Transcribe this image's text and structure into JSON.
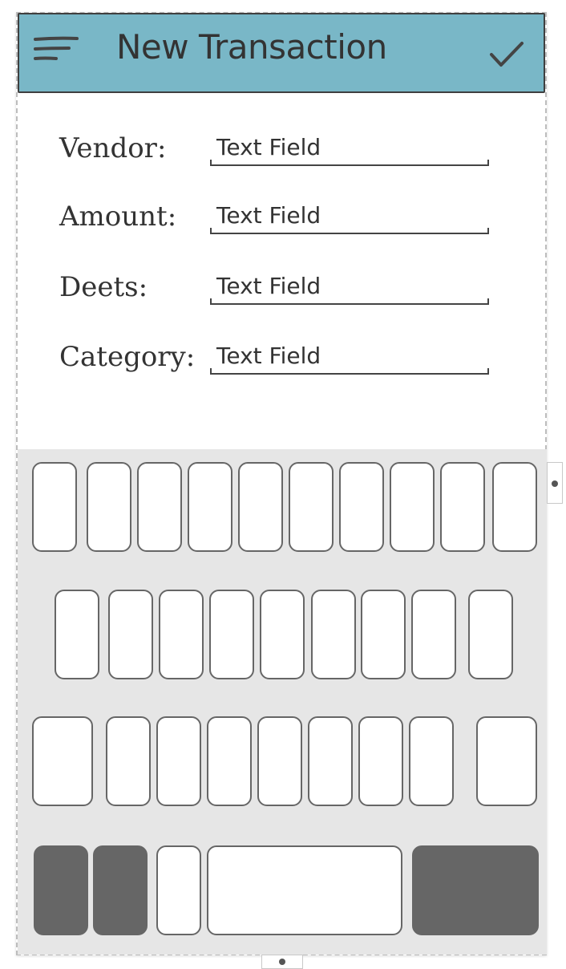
{
  "header": {
    "title": "New Transaction",
    "menu_icon": "hamburger-menu-icon",
    "confirm_icon": "checkmark-icon",
    "background_color": "#79b7c7"
  },
  "form": {
    "fields": [
      {
        "label": "Vendor:",
        "value": "Text Field"
      },
      {
        "label": "Amount:",
        "value": "Text Field"
      },
      {
        "label": "Deets:",
        "value": "Text Field"
      },
      {
        "label": "Category:",
        "value": "Text Field"
      }
    ]
  },
  "keyboard": {
    "background_color": "#e6e6e6",
    "dark_key_color": "#666666"
  }
}
